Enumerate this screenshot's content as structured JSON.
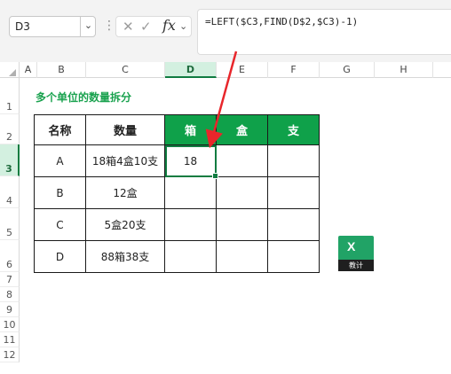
{
  "formula_bar": {
    "name_box": "D3",
    "formula": "=LEFT($C3,FIND(D$2,$C3)-1)",
    "fx_label": "fx"
  },
  "columns": [
    "A",
    "B",
    "C",
    "D",
    "E",
    "F",
    "G",
    "H"
  ],
  "rows": [
    "1",
    "2",
    "3",
    "4",
    "5",
    "6",
    "7",
    "8",
    "9",
    "10",
    "11",
    "12"
  ],
  "selected_cell": {
    "column": "D",
    "row": "3"
  },
  "sheet": {
    "title": "多个单位的数量拆分",
    "headers": [
      "名称",
      "数量",
      "箱",
      "盒",
      "支"
    ],
    "data": [
      [
        "A",
        "18箱4盒10支",
        "18",
        "",
        ""
      ],
      [
        "B",
        "12盒",
        "",
        "",
        ""
      ],
      [
        "C",
        "5盒20支",
        "",
        "",
        ""
      ],
      [
        "D",
        "88箱38支",
        "",
        "",
        ""
      ]
    ]
  },
  "logo": {
    "letter": "X",
    "caption": "教计"
  },
  "colors": {
    "accent_green": "#0fa14a",
    "title_green": "#1aa24f",
    "selection_green": "#107c41",
    "arrow_red": "#e8262b"
  },
  "icons": [
    "chevron-down-icon",
    "more-options-icon",
    "cancel-icon",
    "enter-icon",
    "function-icon",
    "excel-logo-icon"
  ]
}
